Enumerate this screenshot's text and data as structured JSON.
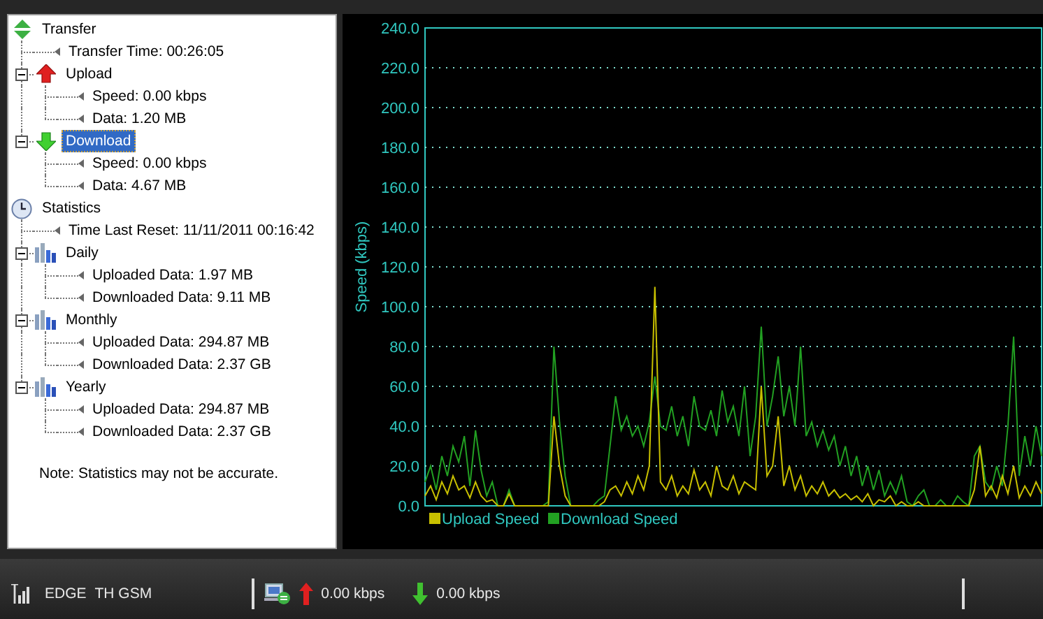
{
  "tree": [
    {
      "label": "Transfer",
      "kind": "transfer",
      "selected": false,
      "children": [
        {
          "label": "Transfer Time: 00:26:05",
          "kind": "leaf",
          "selected": false
        },
        {
          "label": "Upload",
          "kind": "upload",
          "expanded": true,
          "selected": false,
          "children": [
            {
              "label": "Speed: 0.00 kbps",
              "kind": "leaf",
              "selected": false
            },
            {
              "label": "Data: 1.20 MB",
              "kind": "leaf",
              "selected": false
            }
          ]
        },
        {
          "label": "Download",
          "kind": "download",
          "expanded": true,
          "selected": true,
          "children": [
            {
              "label": "Speed: 0.00 kbps",
              "kind": "leaf",
              "selected": false
            },
            {
              "label": "Data: 4.67 MB",
              "kind": "leaf",
              "selected": false
            }
          ]
        }
      ]
    },
    {
      "label": "Statistics",
      "kind": "clock",
      "selected": false,
      "children": [
        {
          "label": "Time Last Reset: 11/11/2011 00:16:42",
          "kind": "leaf",
          "selected": false
        },
        {
          "label": "Daily",
          "kind": "bars",
          "expanded": true,
          "selected": false,
          "children": [
            {
              "label": "Uploaded Data: 1.97 MB",
              "kind": "leaf",
              "selected": false
            },
            {
              "label": "Downloaded Data: 9.11 MB",
              "kind": "leaf",
              "selected": false
            }
          ]
        },
        {
          "label": "Monthly",
          "kind": "bars",
          "expanded": true,
          "selected": false,
          "children": [
            {
              "label": "Uploaded Data: 294.87 MB",
              "kind": "leaf",
              "selected": false
            },
            {
              "label": "Downloaded Data: 2.37 GB",
              "kind": "leaf",
              "selected": false
            }
          ]
        },
        {
          "label": "Yearly",
          "kind": "bars",
          "expanded": true,
          "selected": false,
          "children": [
            {
              "label": "Uploaded Data: 294.87 MB",
              "kind": "leaf",
              "selected": false
            },
            {
              "label": "Downloaded Data: 2.37 GB",
              "kind": "leaf",
              "selected": false
            }
          ]
        }
      ]
    }
  ],
  "note": "Note: Statistics may not be accurate.",
  "chart": {
    "chart_data": {
      "type": "line",
      "ylabel": "Speed (kbps)",
      "ylim": [
        0,
        240
      ],
      "grid": true,
      "legend": true,
      "yticks": [
        {
          "value": 0,
          "label": "0.0"
        },
        {
          "value": 20,
          "label": "20.0"
        },
        {
          "value": 40,
          "label": "40.0"
        },
        {
          "value": 60,
          "label": "60.0"
        },
        {
          "value": 80,
          "label": "80.0"
        },
        {
          "value": 100,
          "label": "100.0"
        },
        {
          "value": 120,
          "label": "120.0"
        },
        {
          "value": 140,
          "label": "140.0"
        },
        {
          "value": 160,
          "label": "160.0"
        },
        {
          "value": 180,
          "label": "180.0"
        },
        {
          "value": 200,
          "label": "200.0"
        },
        {
          "value": 220,
          "label": "220.0"
        },
        {
          "value": 240,
          "label": "240.0"
        }
      ],
      "series": [
        {
          "name": "Upload Speed",
          "color": "#c8c000",
          "values": [
            5,
            10,
            3,
            12,
            6,
            15,
            8,
            10,
            4,
            12,
            5,
            2,
            3,
            0,
            0,
            6,
            0,
            0,
            0,
            0,
            0,
            0,
            0,
            45,
            20,
            5,
            0,
            0,
            0,
            0,
            0,
            0,
            2,
            8,
            10,
            5,
            12,
            6,
            15,
            8,
            20,
            110,
            12,
            8,
            15,
            5,
            10,
            6,
            18,
            8,
            12,
            5,
            20,
            10,
            8,
            15,
            6,
            12,
            10,
            8,
            60,
            15,
            20,
            45,
            10,
            20,
            8,
            15,
            5,
            10,
            6,
            12,
            5,
            8,
            4,
            6,
            3,
            5,
            2,
            6,
            0,
            3,
            2,
            5,
            0,
            2,
            0,
            0,
            2,
            0,
            0,
            0,
            0,
            0,
            0,
            0,
            0,
            0,
            8,
            30,
            5,
            10,
            4,
            15,
            6,
            20,
            4,
            10,
            5,
            12,
            6
          ]
        },
        {
          "name": "Download Speed",
          "color": "#22a022",
          "values": [
            12,
            20,
            8,
            25,
            15,
            30,
            22,
            35,
            10,
            38,
            18,
            5,
            12,
            0,
            0,
            8,
            0,
            0,
            0,
            0,
            0,
            0,
            2,
            80,
            42,
            15,
            0,
            0,
            0,
            0,
            0,
            3,
            5,
            30,
            55,
            38,
            45,
            35,
            40,
            30,
            42,
            65,
            40,
            38,
            50,
            35,
            45,
            30,
            55,
            40,
            38,
            48,
            35,
            58,
            42,
            50,
            35,
            60,
            25,
            45,
            90,
            40,
            55,
            75,
            45,
            60,
            40,
            80,
            35,
            42,
            30,
            38,
            28,
            35,
            20,
            30,
            15,
            25,
            10,
            20,
            8,
            18,
            5,
            12,
            6,
            15,
            2,
            0,
            5,
            8,
            0,
            0,
            3,
            0,
            0,
            5,
            2,
            0,
            25,
            30,
            12,
            8,
            20,
            10,
            40,
            85,
            15,
            35,
            20,
            40,
            25
          ]
        }
      ]
    }
  },
  "status_bar": {
    "network": [
      "EDGE",
      "TH GSM"
    ],
    "upload_rate": "0.00 kbps",
    "download_rate": "0.00 kbps"
  }
}
